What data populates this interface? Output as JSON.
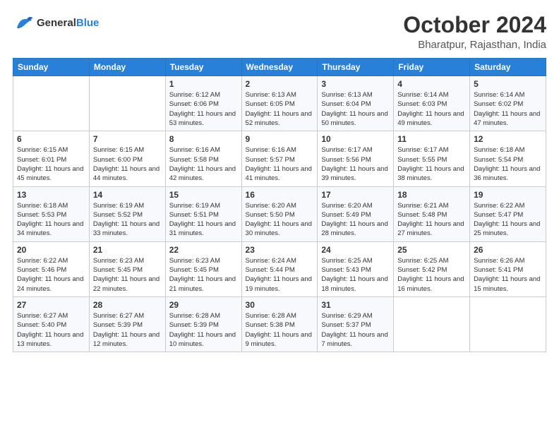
{
  "logo": {
    "general": "General",
    "blue": "Blue"
  },
  "title": {
    "month": "October 2024",
    "location": "Bharatpur, Rajasthan, India"
  },
  "weekdays": [
    "Sunday",
    "Monday",
    "Tuesday",
    "Wednesday",
    "Thursday",
    "Friday",
    "Saturday"
  ],
  "weeks": [
    [
      {
        "day": "",
        "info": ""
      },
      {
        "day": "",
        "info": ""
      },
      {
        "day": "1",
        "info": "Sunrise: 6:12 AM\nSunset: 6:06 PM\nDaylight: 11 hours and 53 minutes."
      },
      {
        "day": "2",
        "info": "Sunrise: 6:13 AM\nSunset: 6:05 PM\nDaylight: 11 hours and 52 minutes."
      },
      {
        "day": "3",
        "info": "Sunrise: 6:13 AM\nSunset: 6:04 PM\nDaylight: 11 hours and 50 minutes."
      },
      {
        "day": "4",
        "info": "Sunrise: 6:14 AM\nSunset: 6:03 PM\nDaylight: 11 hours and 49 minutes."
      },
      {
        "day": "5",
        "info": "Sunrise: 6:14 AM\nSunset: 6:02 PM\nDaylight: 11 hours and 47 minutes."
      }
    ],
    [
      {
        "day": "6",
        "info": "Sunrise: 6:15 AM\nSunset: 6:01 PM\nDaylight: 11 hours and 45 minutes."
      },
      {
        "day": "7",
        "info": "Sunrise: 6:15 AM\nSunset: 6:00 PM\nDaylight: 11 hours and 44 minutes."
      },
      {
        "day": "8",
        "info": "Sunrise: 6:16 AM\nSunset: 5:58 PM\nDaylight: 11 hours and 42 minutes."
      },
      {
        "day": "9",
        "info": "Sunrise: 6:16 AM\nSunset: 5:57 PM\nDaylight: 11 hours and 41 minutes."
      },
      {
        "day": "10",
        "info": "Sunrise: 6:17 AM\nSunset: 5:56 PM\nDaylight: 11 hours and 39 minutes."
      },
      {
        "day": "11",
        "info": "Sunrise: 6:17 AM\nSunset: 5:55 PM\nDaylight: 11 hours and 38 minutes."
      },
      {
        "day": "12",
        "info": "Sunrise: 6:18 AM\nSunset: 5:54 PM\nDaylight: 11 hours and 36 minutes."
      }
    ],
    [
      {
        "day": "13",
        "info": "Sunrise: 6:18 AM\nSunset: 5:53 PM\nDaylight: 11 hours and 34 minutes."
      },
      {
        "day": "14",
        "info": "Sunrise: 6:19 AM\nSunset: 5:52 PM\nDaylight: 11 hours and 33 minutes."
      },
      {
        "day": "15",
        "info": "Sunrise: 6:19 AM\nSunset: 5:51 PM\nDaylight: 11 hours and 31 minutes."
      },
      {
        "day": "16",
        "info": "Sunrise: 6:20 AM\nSunset: 5:50 PM\nDaylight: 11 hours and 30 minutes."
      },
      {
        "day": "17",
        "info": "Sunrise: 6:20 AM\nSunset: 5:49 PM\nDaylight: 11 hours and 28 minutes."
      },
      {
        "day": "18",
        "info": "Sunrise: 6:21 AM\nSunset: 5:48 PM\nDaylight: 11 hours and 27 minutes."
      },
      {
        "day": "19",
        "info": "Sunrise: 6:22 AM\nSunset: 5:47 PM\nDaylight: 11 hours and 25 minutes."
      }
    ],
    [
      {
        "day": "20",
        "info": "Sunrise: 6:22 AM\nSunset: 5:46 PM\nDaylight: 11 hours and 24 minutes."
      },
      {
        "day": "21",
        "info": "Sunrise: 6:23 AM\nSunset: 5:45 PM\nDaylight: 11 hours and 22 minutes."
      },
      {
        "day": "22",
        "info": "Sunrise: 6:23 AM\nSunset: 5:45 PM\nDaylight: 11 hours and 21 minutes."
      },
      {
        "day": "23",
        "info": "Sunrise: 6:24 AM\nSunset: 5:44 PM\nDaylight: 11 hours and 19 minutes."
      },
      {
        "day": "24",
        "info": "Sunrise: 6:25 AM\nSunset: 5:43 PM\nDaylight: 11 hours and 18 minutes."
      },
      {
        "day": "25",
        "info": "Sunrise: 6:25 AM\nSunset: 5:42 PM\nDaylight: 11 hours and 16 minutes."
      },
      {
        "day": "26",
        "info": "Sunrise: 6:26 AM\nSunset: 5:41 PM\nDaylight: 11 hours and 15 minutes."
      }
    ],
    [
      {
        "day": "27",
        "info": "Sunrise: 6:27 AM\nSunset: 5:40 PM\nDaylight: 11 hours and 13 minutes."
      },
      {
        "day": "28",
        "info": "Sunrise: 6:27 AM\nSunset: 5:39 PM\nDaylight: 11 hours and 12 minutes."
      },
      {
        "day": "29",
        "info": "Sunrise: 6:28 AM\nSunset: 5:39 PM\nDaylight: 11 hours and 10 minutes."
      },
      {
        "day": "30",
        "info": "Sunrise: 6:28 AM\nSunset: 5:38 PM\nDaylight: 11 hours and 9 minutes."
      },
      {
        "day": "31",
        "info": "Sunrise: 6:29 AM\nSunset: 5:37 PM\nDaylight: 11 hours and 7 minutes."
      },
      {
        "day": "",
        "info": ""
      },
      {
        "day": "",
        "info": ""
      }
    ]
  ]
}
